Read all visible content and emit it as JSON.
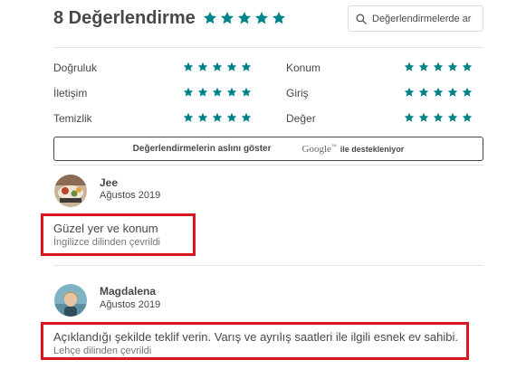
{
  "header": {
    "title": "8 Değerlendirme",
    "star_count": 5,
    "search_placeholder": "Değerlendirmelerde ar"
  },
  "ratings": [
    {
      "label": "Doğruluk",
      "stars": 5
    },
    {
      "label": "Konum",
      "stars": 5
    },
    {
      "label": "İletişim",
      "stars": 5
    },
    {
      "label": "Giriş",
      "stars": 5
    },
    {
      "label": "Temizlik",
      "stars": 5
    },
    {
      "label": "Değer",
      "stars": 5
    }
  ],
  "translate_button": {
    "label": "Değerlendirmelerin aslını göster",
    "google": "Google",
    "tm": "™",
    "powered": "ile destekleniyor"
  },
  "reviews": [
    {
      "name": "Jee",
      "date": "Ağustos 2019",
      "text": "Güzel yer ve konum",
      "note": "İngilizce dilinden çevrildi"
    },
    {
      "name": "Magdalena",
      "date": "Ağustos 2019",
      "text": "Açıklandığı şekilde teklif verin. Varış ve ayrılış saatleri ile ilgili esnek ev sahibi.",
      "note": "Lehçe dilinden çevrildi"
    }
  ],
  "colors": {
    "star": "#008489",
    "highlight": "#d8171e",
    "text": "#484848"
  }
}
